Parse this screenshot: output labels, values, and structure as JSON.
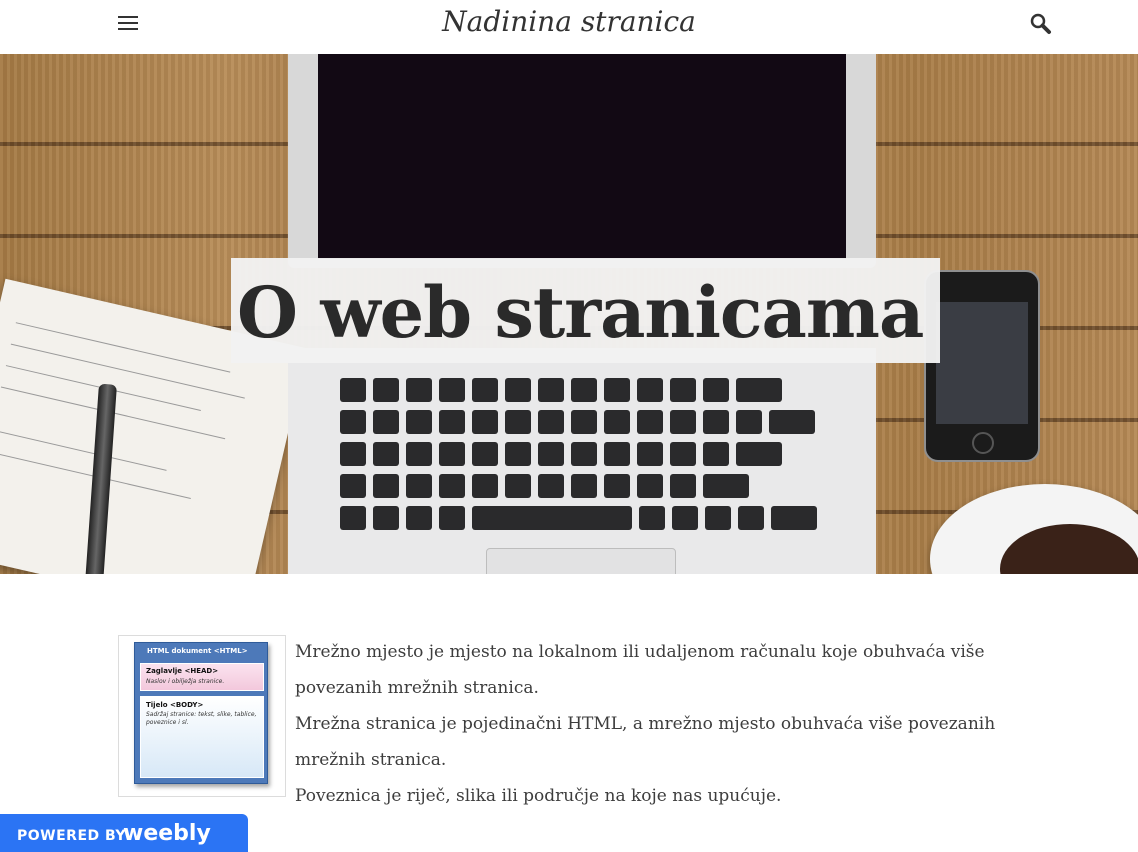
{
  "header": {
    "site_title": "Nadinina stranica",
    "menu_icon": "hamburger-menu-icon",
    "search_icon": "search-icon"
  },
  "hero": {
    "title": "O web stranicama"
  },
  "figure": {
    "doc_title": "HTML dokument <HTML>",
    "head_label": "Zaglavlje <HEAD>",
    "head_desc": "Naslov i obilježja stranice.",
    "body_label": "Tijelo <BODY>",
    "body_desc": "Sadržaj stranice: tekst, slike, tablice, poveznice i sl."
  },
  "content": {
    "paragraphs": [
      "Mrežno mjesto je mjesto na lokalnom ili udaljenom računalu koje obuhvaća više povezanih mrežnih stranica.",
      "Mrežna stranica je pojedinačni HTML, a mrežno mjesto obuhvaća više povezanih mrežnih stranica.",
      "Poveznica je riječ, slika ili područje na koje nas upućuje."
    ]
  },
  "badge": {
    "powered_by": "POWERED BY",
    "brand": "weebly",
    "brand_color": "#2b74f4"
  }
}
